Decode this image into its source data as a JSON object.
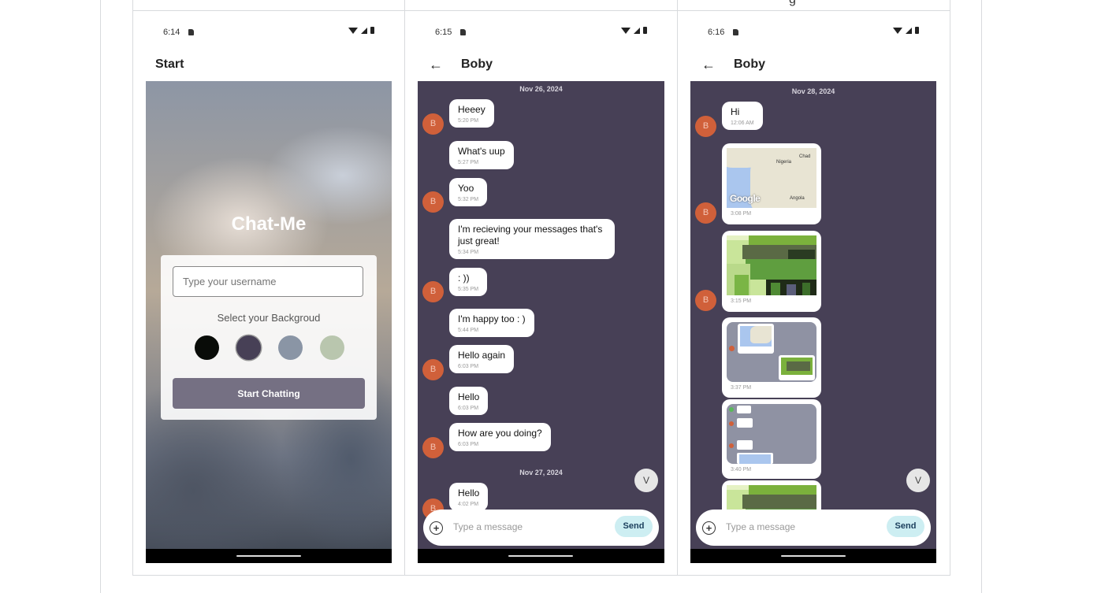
{
  "header_fragments": {
    "left": "",
    "right": "g"
  },
  "start_screen": {
    "status_time": "6:14",
    "title": "Start",
    "app_name": "Chat-Me",
    "username_placeholder": "Type your username",
    "background_label": "Select your Backgroud",
    "swatch_colors": [
      "#090C08",
      "#474056",
      "#8A95A5",
      "#B9C6AE"
    ],
    "selected_swatch": 1,
    "start_button": "Start Chatting"
  },
  "chat1": {
    "status_time": "6:15",
    "title": "Boby",
    "day_labels": [
      "Nov 26, 2024",
      "Nov 27, 2024"
    ],
    "messages": [
      {
        "text": "Heeey",
        "time": "5:20 PM"
      },
      {
        "text": "What's uup",
        "time": "5:27 PM"
      },
      {
        "text": "Yoo",
        "time": "5:32 PM"
      },
      {
        "text": "I'm recieving your messages that's just great!",
        "time": "5:34 PM"
      },
      {
        "text": ": ))",
        "time": "5:35 PM"
      },
      {
        "text": "I'm happy too : )",
        "time": "5:44 PM"
      },
      {
        "text": "Hello again",
        "time": "6:03 PM"
      },
      {
        "text": "Hello",
        "time": "6:03 PM"
      },
      {
        "text": "How are you doing?",
        "time": "6:03 PM"
      },
      {
        "text": "Hello",
        "time": "4:02 PM"
      }
    ],
    "avatar_letter": "B",
    "scroll_letter": "V",
    "input_placeholder": "Type a message",
    "send_label": "Send"
  },
  "chat2": {
    "status_time": "6:16",
    "title": "Boby",
    "day_label": "Nov 28, 2024",
    "messages": [
      {
        "text": "Hi",
        "time": "12:06 AM"
      },
      {
        "kind": "map",
        "time": "3:08 PM",
        "labels": [
          "Chad",
          "Nigeria",
          "Angola"
        ],
        "logo": "Google"
      },
      {
        "kind": "image",
        "time": "3:15 PM"
      },
      {
        "kind": "screenshot",
        "time": "3:37 PM"
      },
      {
        "kind": "screenshot",
        "time": "3:40 PM"
      }
    ],
    "avatar_letter": "B",
    "scroll_letter": "V",
    "input_placeholder": "Type a message",
    "send_label": "Send"
  }
}
